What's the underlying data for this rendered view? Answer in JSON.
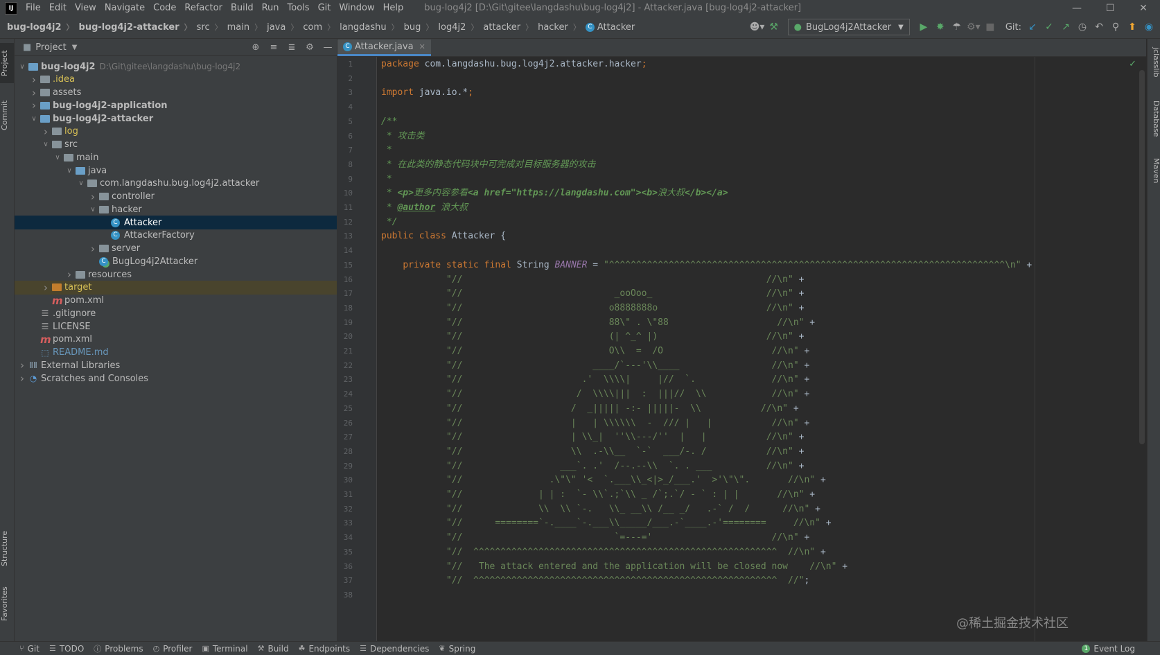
{
  "menubar": {
    "logo": "IJ",
    "items": [
      "File",
      "Edit",
      "View",
      "Navigate",
      "Code",
      "Refactor",
      "Build",
      "Run",
      "Tools",
      "Git",
      "Window",
      "Help"
    ],
    "title": "bug-log4j2 [D:\\Git\\gitee\\langdashu\\bug-log4j2] - Attacker.java [bug-log4j2-attacker]"
  },
  "breadcrumbs": [
    "bug-log4j2",
    "bug-log4j2-attacker",
    "src",
    "main",
    "java",
    "com",
    "langdashu",
    "bug",
    "log4j2",
    "attacker",
    "hacker",
    "Attacker"
  ],
  "toolbar": {
    "run_config": "BugLog4j2Attacker",
    "git_label": "Git:"
  },
  "left_tabs": [
    "Project",
    "Commit",
    "Structure",
    "Favorites"
  ],
  "right_tabs": [
    "jclasslib",
    "Database",
    "Maven"
  ],
  "project": {
    "title": "Project",
    "tree": [
      {
        "depth": 0,
        "arrow": "v",
        "icon": "module",
        "label": "bug-log4j2",
        "bold": true,
        "path": "D:\\Git\\gitee\\langdashu\\bug-log4j2"
      },
      {
        "depth": 1,
        "arrow": ">",
        "icon": "folder",
        "label": ".idea",
        "color": "#d6bf55"
      },
      {
        "depth": 1,
        "arrow": ">",
        "icon": "folder",
        "label": "assets"
      },
      {
        "depth": 1,
        "arrow": ">",
        "icon": "module",
        "label": "bug-log4j2-application",
        "bold": true
      },
      {
        "depth": 1,
        "arrow": "v",
        "icon": "module",
        "label": "bug-log4j2-attacker",
        "bold": true
      },
      {
        "depth": 2,
        "arrow": ">",
        "icon": "folder",
        "label": "log",
        "color": "#d6bf55"
      },
      {
        "depth": 2,
        "arrow": "v",
        "icon": "folder",
        "label": "src"
      },
      {
        "depth": 3,
        "arrow": "v",
        "icon": "folder",
        "label": "main"
      },
      {
        "depth": 4,
        "arrow": "v",
        "icon": "folder-blue",
        "label": "java"
      },
      {
        "depth": 5,
        "arrow": "v",
        "icon": "folder",
        "label": "com.langdashu.bug.log4j2.attacker"
      },
      {
        "depth": 6,
        "arrow": ">",
        "icon": "folder",
        "label": "controller"
      },
      {
        "depth": 6,
        "arrow": "v",
        "icon": "folder",
        "label": "hacker"
      },
      {
        "depth": 7,
        "arrow": "",
        "icon": "class",
        "label": "Attacker",
        "selected": true
      },
      {
        "depth": 7,
        "arrow": "",
        "icon": "class",
        "label": "AttackerFactory"
      },
      {
        "depth": 6,
        "arrow": ">",
        "icon": "folder",
        "label": "server"
      },
      {
        "depth": 6,
        "arrow": "",
        "icon": "class-run",
        "label": "BugLog4j2Attacker"
      },
      {
        "depth": 4,
        "arrow": ">",
        "icon": "folder",
        "label": "resources"
      },
      {
        "depth": 2,
        "arrow": ">",
        "icon": "folder-orange",
        "label": "target",
        "color": "#d6bf55",
        "target": true
      },
      {
        "depth": 2,
        "arrow": "",
        "icon": "maven",
        "label": "pom.xml"
      },
      {
        "depth": 1,
        "arrow": "",
        "icon": "file",
        "label": ".gitignore"
      },
      {
        "depth": 1,
        "arrow": "",
        "icon": "file",
        "label": "LICENSE"
      },
      {
        "depth": 1,
        "arrow": "",
        "icon": "maven",
        "label": "pom.xml"
      },
      {
        "depth": 1,
        "arrow": "",
        "icon": "md",
        "label": "README.md",
        "color": "#6897bb"
      },
      {
        "depth": 0,
        "arrow": ">",
        "icon": "lib",
        "label": "External Libraries"
      },
      {
        "depth": 0,
        "arrow": ">",
        "icon": "scratch",
        "label": "Scratches and Consoles"
      }
    ]
  },
  "editor": {
    "tab": "Attacker.java",
    "lines": [
      [
        [
          "kw",
          "package "
        ],
        [
          "id",
          "com.langdashu.bug.log4j2.attacker.hacker"
        ],
        [
          "kw",
          ";"
        ]
      ],
      [],
      [
        [
          "kw",
          "import "
        ],
        [
          "id",
          "java.io.*"
        ],
        [
          "kw",
          ";"
        ]
      ],
      [],
      [
        [
          "cm",
          "/**"
        ]
      ],
      [
        [
          "cm",
          " * 攻击类"
        ]
      ],
      [
        [
          "cm",
          " *"
        ]
      ],
      [
        [
          "cm",
          " * 在此类的静态代码块中可完成对目标服务器的攻击"
        ]
      ],
      [
        [
          "cm",
          " *"
        ]
      ],
      [
        [
          "cm",
          " * "
        ],
        [
          "tag",
          "<p>"
        ],
        [
          "cm",
          "更多内容参看"
        ],
        [
          "tag",
          "<a href=\"https://langdashu.com\"><b>"
        ],
        [
          "cm",
          "浪大叔"
        ],
        [
          "tag",
          "</b></a>"
        ]
      ],
      [
        [
          "cm",
          " * "
        ],
        [
          "tag",
          "@author"
        ],
        [
          "cm",
          " 浪大叔"
        ]
      ],
      [
        [
          "cm",
          " */"
        ]
      ],
      [
        [
          "kw",
          "public class "
        ],
        [
          "id",
          "Attacker {"
        ]
      ],
      [],
      [
        [
          "id",
          "    "
        ],
        [
          "kw",
          "private static final "
        ],
        [
          "id",
          "String "
        ],
        [
          "fld",
          "BANNER"
        ],
        [
          "id",
          " = "
        ],
        [
          "st",
          "\"^^^^^^^^^^^^^^^^^^^^^^^^^^^^^^^^^^^^^^^^^^^^^^^^^^^^^^^^^^^^^^^^^^^^^^^^^\\n\""
        ],
        [
          "id",
          " +"
        ]
      ],
      [
        [
          "st",
          "            \"//                                                        //\\n\""
        ],
        [
          "id",
          " +"
        ]
      ],
      [
        [
          "st",
          "            \"//                            _ooOoo_                     //\\n\""
        ],
        [
          "id",
          " +"
        ]
      ],
      [
        [
          "st",
          "            \"//                           o8888888o                    //\\n\""
        ],
        [
          "id",
          " +"
        ]
      ],
      [
        [
          "st",
          "            \"//                           88\\\" . \\\"88                    //\\n\""
        ],
        [
          "id",
          " +"
        ]
      ],
      [
        [
          "st",
          "            \"//                           (| ^_^ |)                    //\\n\""
        ],
        [
          "id",
          " +"
        ]
      ],
      [
        [
          "st",
          "            \"//                           O\\\\  =  /O                    //\\n\""
        ],
        [
          "id",
          " +"
        ]
      ],
      [
        [
          "st",
          "            \"//                        ____/`---'\\\\____                 //\\n\""
        ],
        [
          "id",
          " +"
        ]
      ],
      [
        [
          "st",
          "            \"//                      .'  \\\\\\\\|     |//  `.              //\\n\""
        ],
        [
          "id",
          " +"
        ]
      ],
      [
        [
          "st",
          "            \"//                     /  \\\\\\\\|||  :  |||//  \\\\            //\\n\""
        ],
        [
          "id",
          " +"
        ]
      ],
      [
        [
          "st",
          "            \"//                    /  _||||| -:- |||||-  \\\\           //\\n\""
        ],
        [
          "id",
          " +"
        ]
      ],
      [
        [
          "st",
          "            \"//                    |   | \\\\\\\\\\\\  -  /// |   |           //\\n\""
        ],
        [
          "id",
          " +"
        ]
      ],
      [
        [
          "st",
          "            \"//                    | \\\\_|  ''\\\\---/''  |   |           //\\n\""
        ],
        [
          "id",
          " +"
        ]
      ],
      [
        [
          "st",
          "            \"//                    \\\\  .-\\\\__  `-`  ___/-. /           //\\n\""
        ],
        [
          "id",
          " +"
        ]
      ],
      [
        [
          "st",
          "            \"//                  ___`. .'  /--.--\\\\  `. . ___          //\\n\""
        ],
        [
          "id",
          " +"
        ]
      ],
      [
        [
          "st",
          "            \"//                .\\\"\\\" '<  `.___\\\\_<|>_/___.'  >'\\\"\\\".       //\\n\""
        ],
        [
          "id",
          " +"
        ]
      ],
      [
        [
          "st",
          "            \"//              | | :  `- \\\\`.;`\\\\ _ /`;.`/ - ` : | |       //\\n\""
        ],
        [
          "id",
          " +"
        ]
      ],
      [
        [
          "st",
          "            \"//              \\\\  \\\\ `-.   \\\\_ __\\\\ /__ _/   .-` /  /      //\\n\""
        ],
        [
          "id",
          " +"
        ]
      ],
      [
        [
          "st",
          "            \"//      ========`-.____`-.___\\\\_____/___.-`____.-'========     //\\n\""
        ],
        [
          "id",
          " +"
        ]
      ],
      [
        [
          "st",
          "            \"//                            `=---='                      //\\n\""
        ],
        [
          "id",
          " +"
        ]
      ],
      [
        [
          "st",
          "            \"//  ^^^^^^^^^^^^^^^^^^^^^^^^^^^^^^^^^^^^^^^^^^^^^^^^^^^^^^^^  //\\n\""
        ],
        [
          "id",
          " +"
        ]
      ],
      [
        [
          "st",
          "            \"//   The attack entered and the application will be closed now    //\\n\""
        ],
        [
          "id",
          " +"
        ]
      ],
      [
        [
          "st",
          "            \"//  ^^^^^^^^^^^^^^^^^^^^^^^^^^^^^^^^^^^^^^^^^^^^^^^^^^^^^^^^  //\""
        ],
        [
          "id",
          ";"
        ]
      ],
      []
    ]
  },
  "bottom": {
    "tools": [
      {
        "icon": "git-icon",
        "label": "Git"
      },
      {
        "icon": "todo-icon",
        "label": "TODO"
      },
      {
        "icon": "problems-icon",
        "label": "Problems"
      },
      {
        "icon": "profiler-icon",
        "label": "Profiler"
      },
      {
        "icon": "terminal-icon",
        "label": "Terminal"
      },
      {
        "icon": "build-icon",
        "label": "Build"
      },
      {
        "icon": "endpoints-icon",
        "label": "Endpoints"
      },
      {
        "icon": "dependencies-icon",
        "label": "Dependencies"
      },
      {
        "icon": "spring-icon",
        "label": "Spring"
      }
    ],
    "event_log": "Event Log",
    "event_count": "1"
  },
  "watermark": "@稀土掘金技术社区"
}
